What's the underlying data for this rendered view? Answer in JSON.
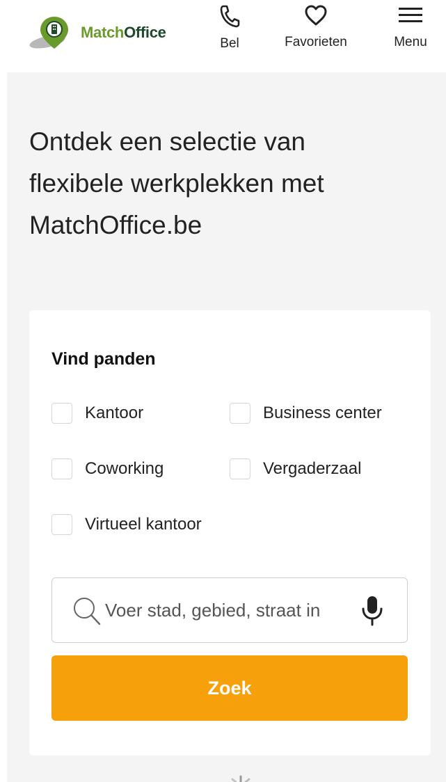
{
  "header": {
    "logo": {
      "text_part1": "Match",
      "text_part2": "Office",
      "brand_green": "#6a9a2c",
      "brand_dark": "#1e4a2b"
    },
    "call": {
      "label": "Bel",
      "icon": "phone-icon"
    },
    "favorites": {
      "label": "Favorieten",
      "icon": "heart-icon"
    },
    "menu": {
      "label": "Menu",
      "icon": "hamburger-icon"
    }
  },
  "main": {
    "headline": "Ontdek een selectie van flexibele werkplekken met MatchOffice.be",
    "search_card": {
      "title": "Vind panden",
      "checkboxes": [
        {
          "label": "Kantoor",
          "checked": false
        },
        {
          "label": "Business center",
          "checked": false
        },
        {
          "label": "Coworking",
          "checked": false
        },
        {
          "label": "Vergaderzaal",
          "checked": false
        },
        {
          "label": "Virtueel kantoor",
          "checked": false
        }
      ],
      "search": {
        "value": "",
        "placeholder": "Voer stad, gebied, straat in",
        "search_icon": "magnifier-icon",
        "mic_icon": "microphone-icon"
      },
      "submit_label": "Zoek",
      "accent_color": "#f6a00b"
    }
  }
}
